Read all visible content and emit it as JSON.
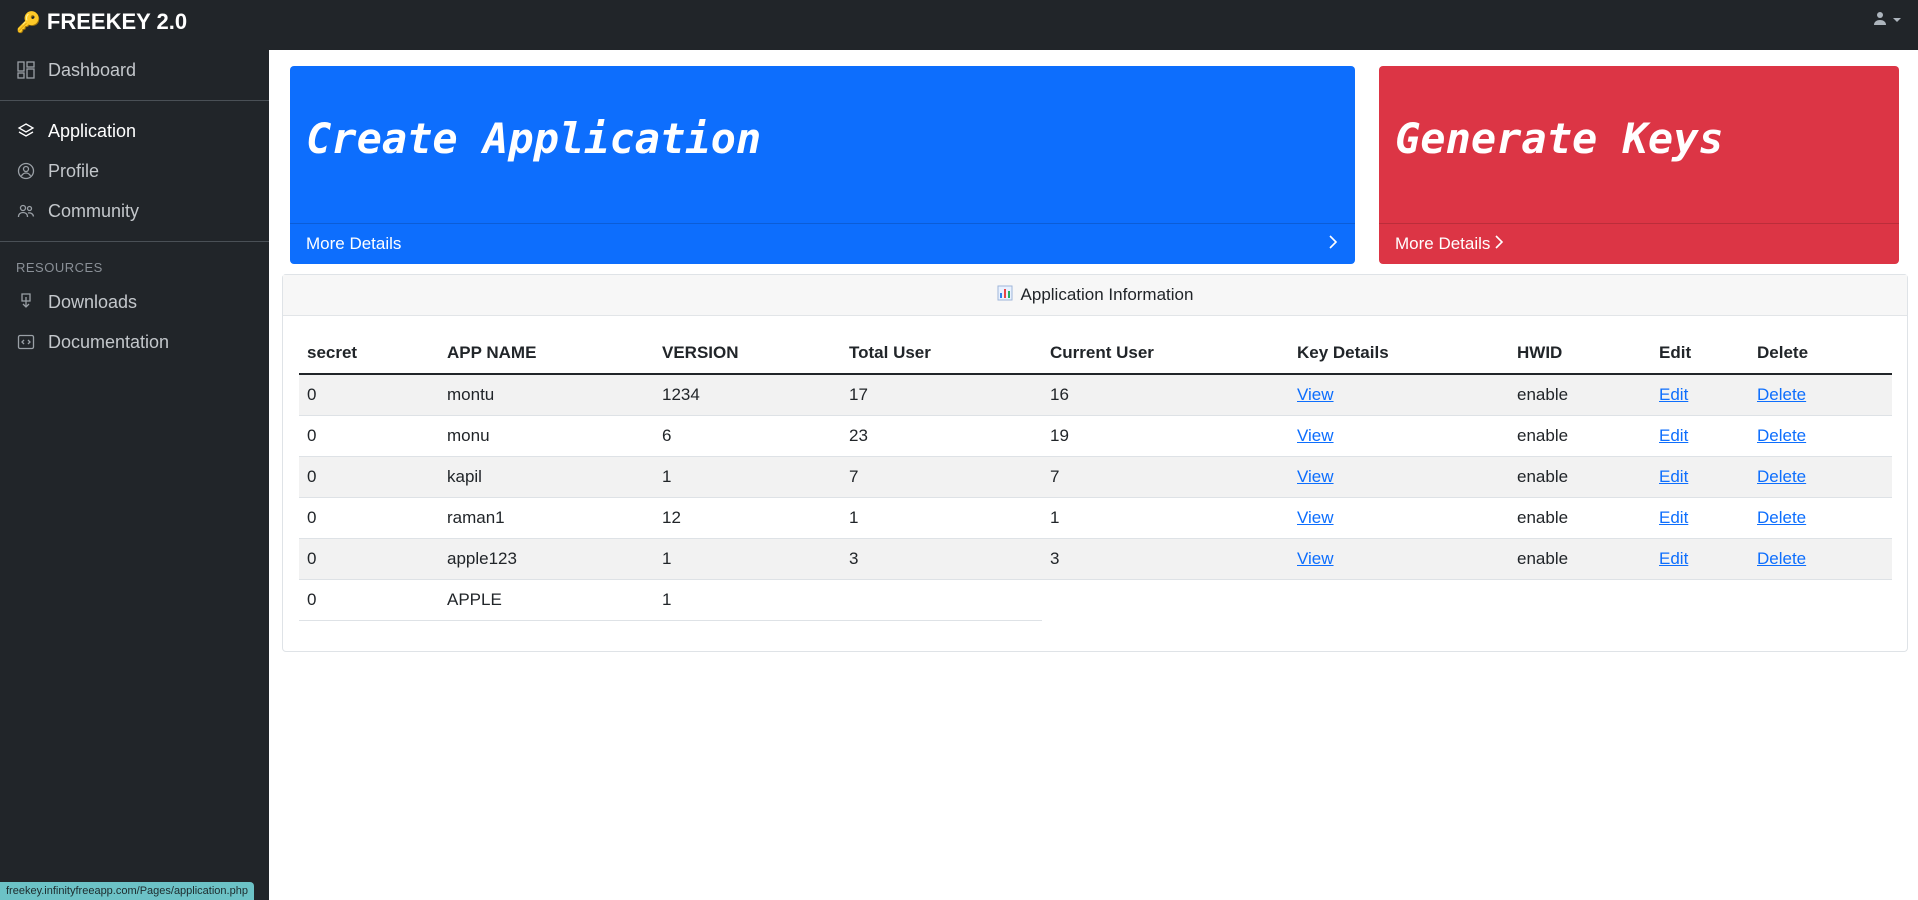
{
  "app": {
    "brand": "FREEKEY 2.0",
    "status_url": "freekey.infinityfreeapp.com/Pages/application.php"
  },
  "sidebar": {
    "items": [
      {
        "label": "Dashboard",
        "icon": "dashboard-icon"
      },
      {
        "label": "Application",
        "icon": "layers-icon"
      },
      {
        "label": "Profile",
        "icon": "user-circle-icon"
      },
      {
        "label": "Community",
        "icon": "people-icon"
      }
    ],
    "resources_heading": "RESOURCES",
    "resources": [
      {
        "label": "Downloads",
        "icon": "download-icon"
      },
      {
        "label": "Documentation",
        "icon": "code-icon"
      }
    ]
  },
  "cards": {
    "create": {
      "title": "Create Application",
      "footer": "More Details",
      "color": "#0d6efd"
    },
    "generate": {
      "title": "Generate Keys",
      "footer": "More Details",
      "color": "#dc3545"
    }
  },
  "info": {
    "title": "Application Information",
    "columns": [
      "secret",
      "APP NAME",
      "VERSION",
      "Total User",
      "Current User",
      "Key Details",
      "HWID",
      "Edit",
      "Delete"
    ],
    "rows": [
      [
        "0",
        "montu",
        "1234",
        "17",
        "16",
        "View",
        "enable",
        "Edit",
        "Delete"
      ],
      [
        "0",
        "monu",
        "6",
        "23",
        "19",
        "View",
        "enable",
        "Edit",
        "Delete"
      ],
      [
        "0",
        "kapil",
        "1",
        "7",
        "7",
        "View",
        "enable",
        "Edit",
        "Delete"
      ],
      [
        "0",
        "raman1",
        "12",
        "1",
        "1",
        "View",
        "enable",
        "Edit",
        "Delete"
      ],
      [
        "0",
        "apple123",
        "1",
        "3",
        "3",
        "View",
        "enable",
        "Edit",
        "Delete"
      ],
      [
        "0",
        "APPLE",
        "1"
      ]
    ]
  }
}
